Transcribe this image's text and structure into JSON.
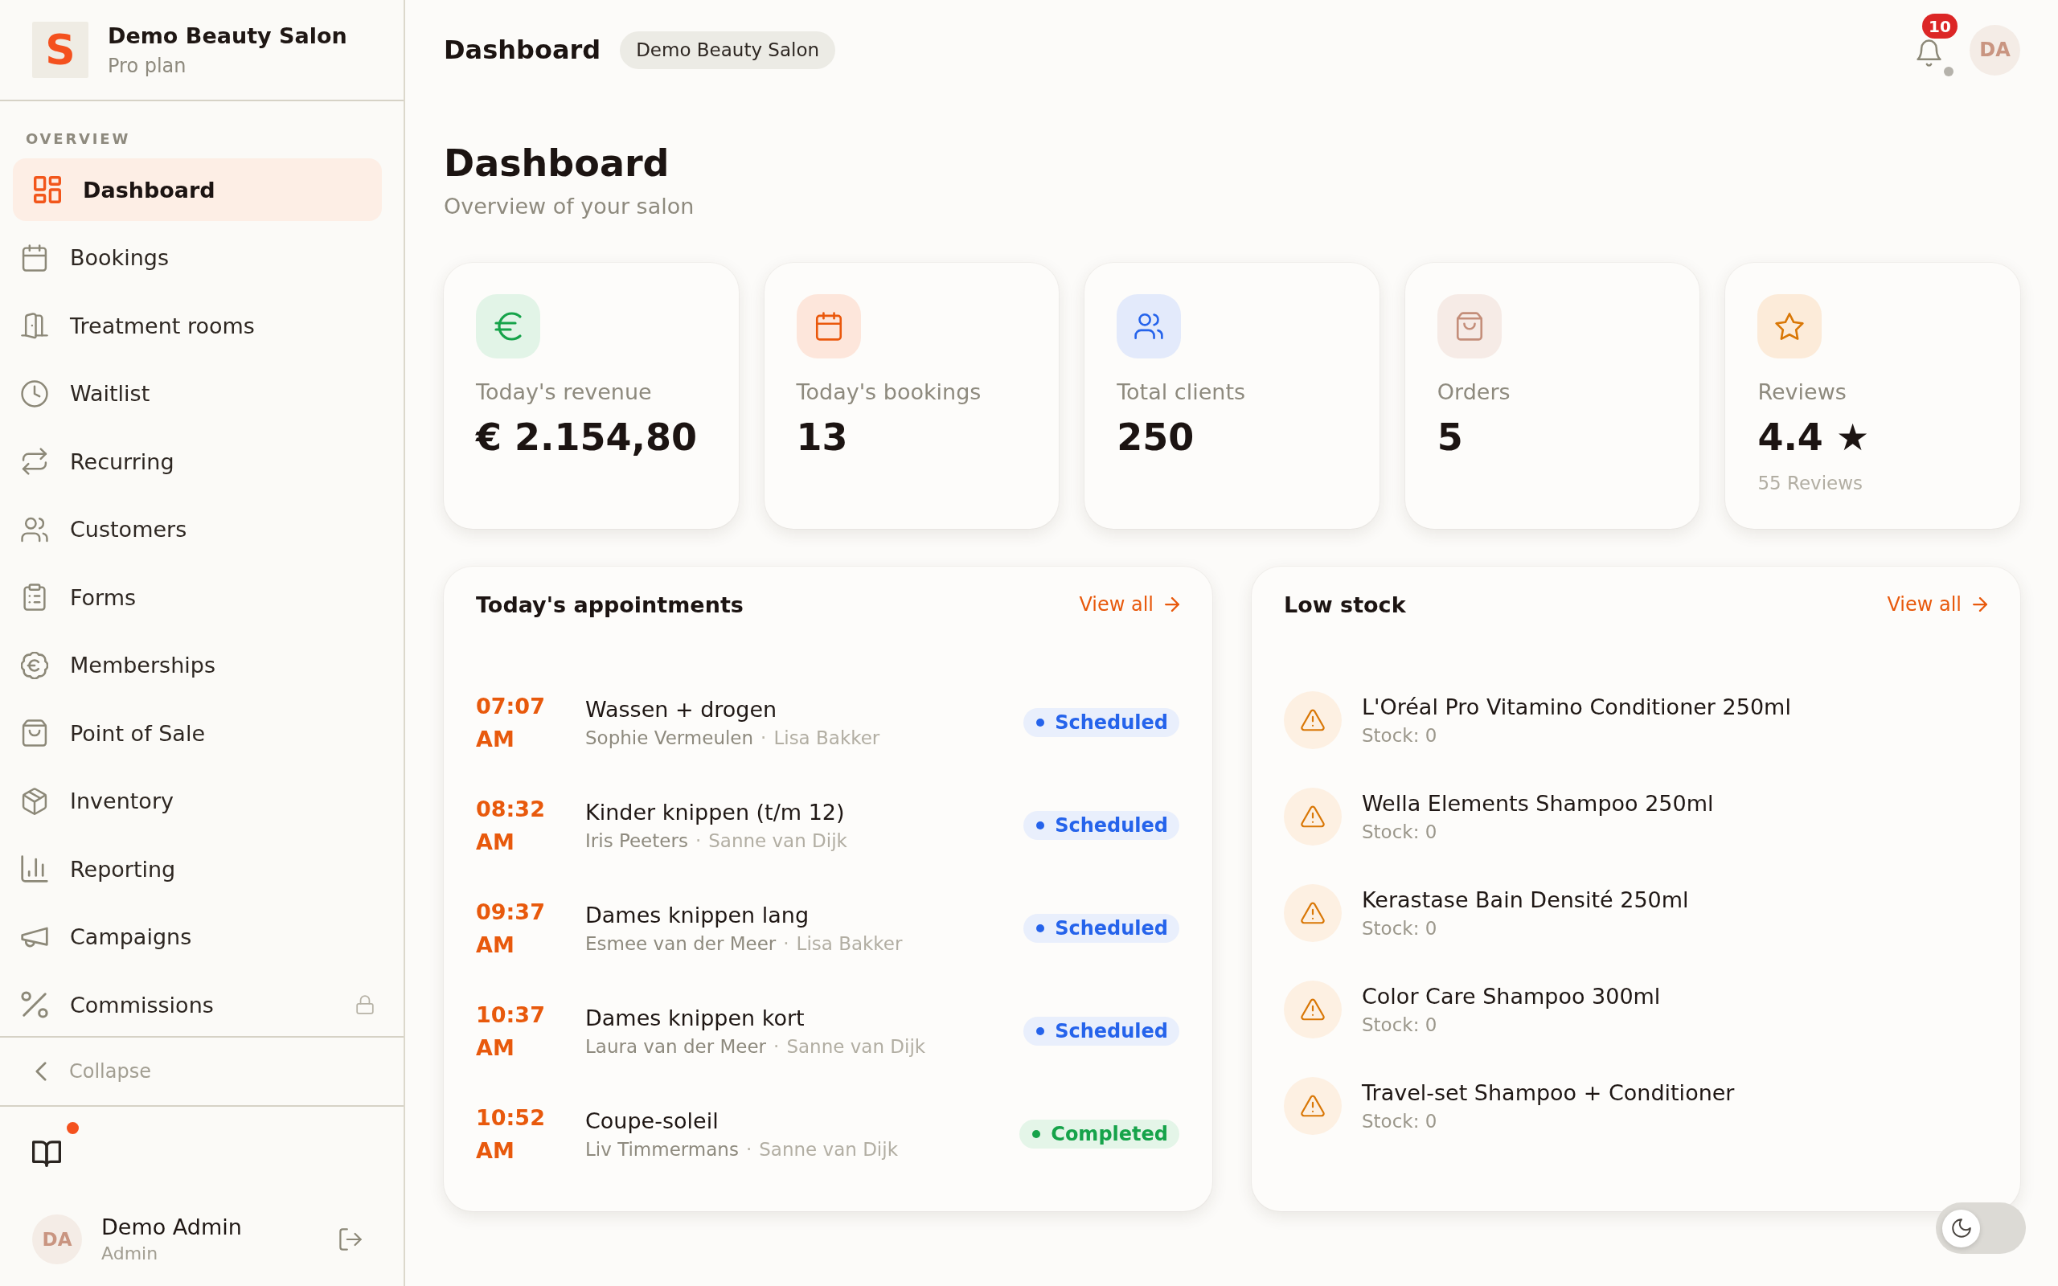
{
  "sidebar": {
    "brand": {
      "logo": "S",
      "name": "Demo Beauty Salon",
      "plan": "Pro plan"
    },
    "section_label": "OVERVIEW",
    "items": [
      {
        "label": "Dashboard",
        "selected": true,
        "locked": false
      },
      {
        "label": "Bookings",
        "selected": false,
        "locked": false
      },
      {
        "label": "Treatment rooms",
        "selected": false,
        "locked": false
      },
      {
        "label": "Waitlist",
        "selected": false,
        "locked": false
      },
      {
        "label": "Recurring",
        "selected": false,
        "locked": false
      },
      {
        "label": "Customers",
        "selected": false,
        "locked": false
      },
      {
        "label": "Forms",
        "selected": false,
        "locked": false
      },
      {
        "label": "Memberships",
        "selected": false,
        "locked": false
      },
      {
        "label": "Point of Sale",
        "selected": false,
        "locked": false
      },
      {
        "label": "Inventory",
        "selected": false,
        "locked": false
      },
      {
        "label": "Reporting",
        "selected": false,
        "locked": false
      },
      {
        "label": "Campaigns",
        "selected": false,
        "locked": false
      },
      {
        "label": "Commissions",
        "selected": false,
        "locked": true
      }
    ],
    "collapse_label": "Collapse",
    "guide": {
      "unread": true
    },
    "user": {
      "initials": "DA",
      "name": "Demo Admin",
      "role": "Admin"
    }
  },
  "header": {
    "title": "Dashboard",
    "salon": "Demo Beauty Salon",
    "notifications": {
      "count": "10",
      "live": false
    },
    "avatar": "DA"
  },
  "page": {
    "title": "Dashboard",
    "subtitle": "Overview of your salon"
  },
  "stats": [
    {
      "kind": "revenue",
      "label": "Today's revenue",
      "value": "€ 2.154,80"
    },
    {
      "kind": "bookings",
      "label": "Today's bookings",
      "value": "13"
    },
    {
      "kind": "clients",
      "label": "Total clients",
      "value": "250"
    },
    {
      "kind": "orders",
      "label": "Orders",
      "value": "5"
    },
    {
      "kind": "reviews",
      "label": "Reviews",
      "value": "4.4 ★",
      "note": "55 Reviews"
    }
  ],
  "appointments": {
    "title": "Today's appointments",
    "link": "View all",
    "rows": [
      {
        "time": "07:07 AM",
        "service": "Wassen + drogen",
        "customer": "Sophie Vermeulen",
        "separator": "·",
        "staff": "Lisa Bakker",
        "status": {
          "kind": "scheduled",
          "label": "Scheduled"
        }
      },
      {
        "time": "08:32 AM",
        "service": "Kinder knippen (t/m 12)",
        "customer": "Iris Peeters",
        "separator": "·",
        "staff": "Sanne van Dijk",
        "status": {
          "kind": "scheduled",
          "label": "Scheduled"
        }
      },
      {
        "time": "09:37 AM",
        "service": "Dames knippen lang",
        "customer": "Esmee van der Meer",
        "separator": "·",
        "staff": "Lisa Bakker",
        "status": {
          "kind": "scheduled",
          "label": "Scheduled"
        }
      },
      {
        "time": "10:37 AM",
        "service": "Dames knippen kort",
        "customer": "Laura van der Meer",
        "separator": "·",
        "staff": "Sanne van Dijk",
        "status": {
          "kind": "scheduled",
          "label": "Scheduled"
        }
      },
      {
        "time": "10:52 AM",
        "service": "Coupe-soleil",
        "customer": "Liv Timmermans",
        "separator": "·",
        "staff": "Sanne van Dijk",
        "status": {
          "kind": "completed",
          "label": "Completed"
        }
      }
    ]
  },
  "low_stock": {
    "title": "Low stock",
    "link": "View all",
    "items": [
      {
        "name": "L'Oréal Pro Vitamino Conditioner 250ml",
        "stock": "Stock: 0"
      },
      {
        "name": "Wella Elements Shampoo 250ml",
        "stock": "Stock: 0"
      },
      {
        "name": "Kerastase Bain Densité 250ml",
        "stock": "Stock: 0"
      },
      {
        "name": "Color Care Shampoo 300ml",
        "stock": "Stock: 0"
      },
      {
        "name": "Travel-set Shampoo + Conditioner",
        "stock": "Stock: 0"
      }
    ]
  },
  "theme_toggle": {
    "on": false
  }
}
